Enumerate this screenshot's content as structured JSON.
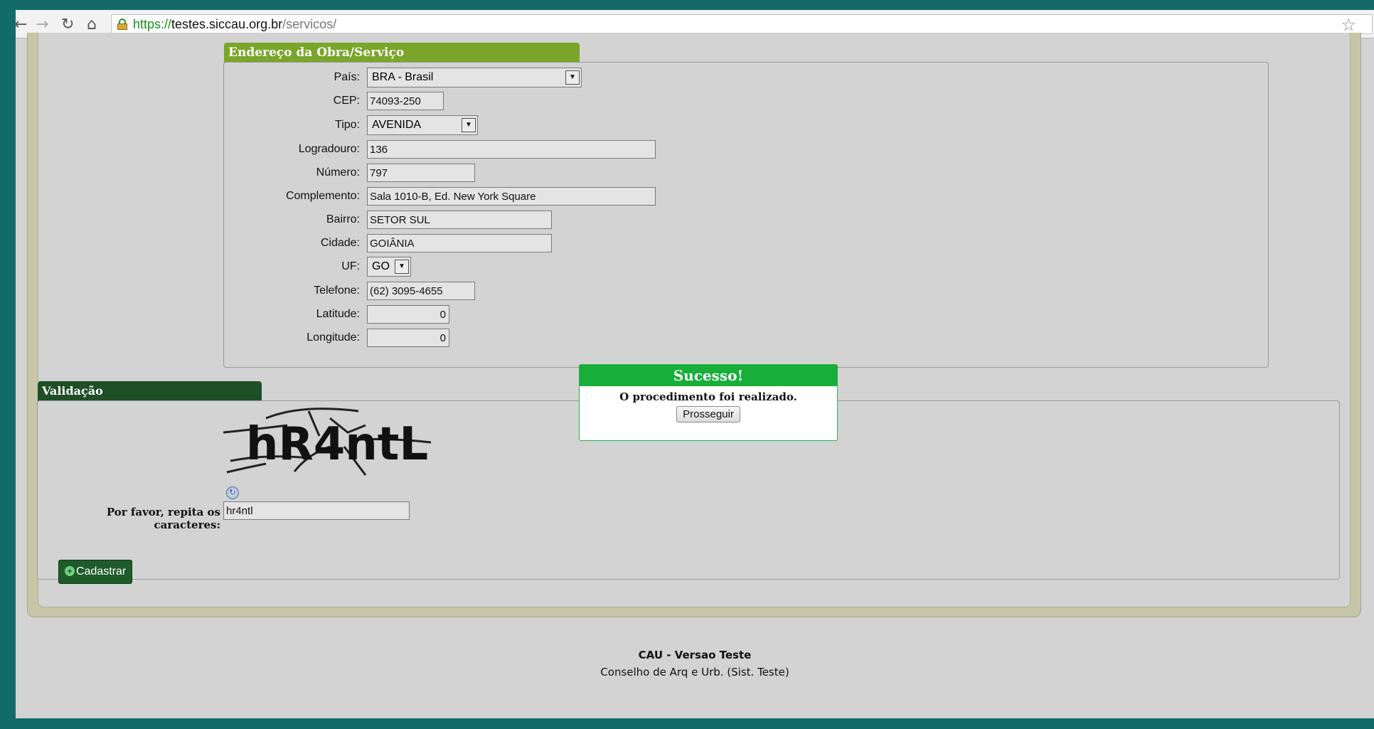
{
  "browser": {
    "url_scheme": "https://",
    "url_host": "testes.siccau.org.br",
    "url_path": "/servicos/"
  },
  "address_section": {
    "title": "Endereço da Obra/Serviço",
    "pais_label": "País:",
    "pais_value": "BRA - Brasil",
    "cep_label": "CEP:",
    "cep_value": "74093-250",
    "tipo_label": "Tipo:",
    "tipo_value": "AVENIDA",
    "logradouro_label": "Logradouro:",
    "logradouro_value": "136",
    "numero_label": "Número:",
    "numero_value": "797",
    "complemento_label": "Complemento:",
    "complemento_value": "Sala 1010-B, Ed. New York Square",
    "bairro_label": "Bairro:",
    "bairro_value": "SETOR SUL",
    "cidade_label": "Cidade:",
    "cidade_value": "GOIÂNIA",
    "uf_label": "UF:",
    "uf_value": "GO",
    "telefone_label": "Telefone:",
    "telefone_value": "(62) 3095-4655",
    "latitude_label": "Latitude:",
    "latitude_value": "0",
    "longitude_label": "Longitude:",
    "longitude_value": "0"
  },
  "validation_section": {
    "title": "Validação",
    "captcha_text": "hR4ntL",
    "repeat_label": "Por favor, repita os caracteres:",
    "repeat_value": "hr4ntl"
  },
  "actions": {
    "cadastrar_label": "Cadastrar"
  },
  "dialog": {
    "title": "Sucesso!",
    "message": "O procedimento foi realizado.",
    "button_label": "Prosseguir"
  },
  "footer": {
    "title": "CAU - Versao Teste",
    "subtitle": "Conselho de Arq e Urb. (Sist. Teste)"
  },
  "colors": {
    "frame_teal": "#136b69",
    "section_green": "#7aa52a",
    "validation_green": "#1f4f26",
    "dialog_green": "#18ae3a"
  }
}
